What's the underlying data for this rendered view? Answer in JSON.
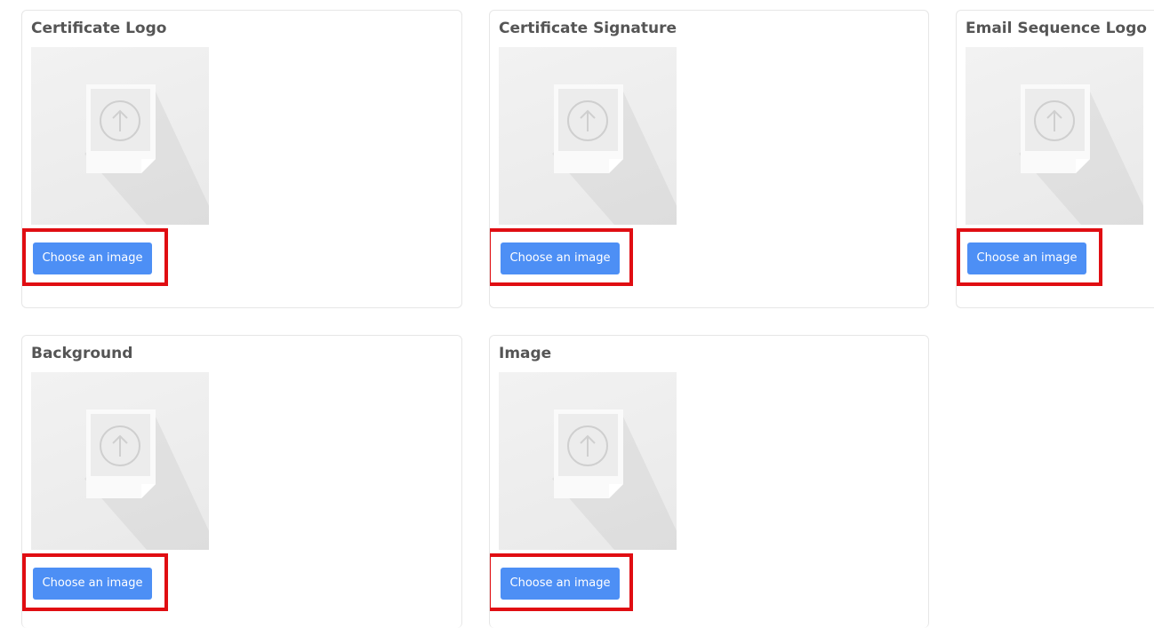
{
  "cards": [
    {
      "title": "Certificate Logo",
      "button_label": "Choose an image",
      "icon": "upload-file-icon"
    },
    {
      "title": "Certificate Signature",
      "button_label": "Choose an image",
      "icon": "upload-file-icon"
    },
    {
      "title": "Email Sequence Logo",
      "button_label": "Choose an image",
      "icon": "upload-file-icon"
    },
    {
      "title": "Background",
      "button_label": "Choose an image",
      "icon": "upload-file-icon"
    },
    {
      "title": "Image",
      "button_label": "Choose an image",
      "icon": "upload-file-icon"
    }
  ],
  "colors": {
    "button": "#4d8ff5",
    "highlight": "#e00d12",
    "title": "#555555"
  }
}
